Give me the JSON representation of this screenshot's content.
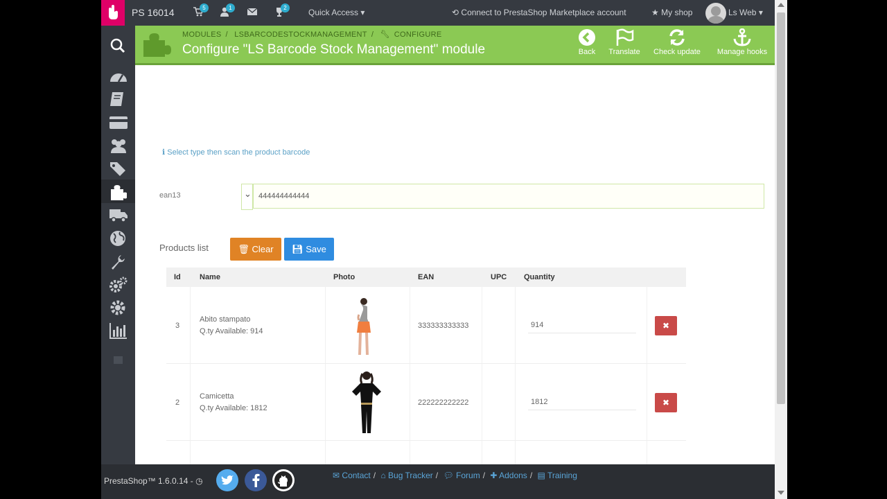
{
  "topbar": {
    "version": "PS 16014",
    "cart_badge": "5",
    "customers_badge": "1",
    "trophy_badge": "2",
    "quick_access": "Quick Access",
    "connect": "Connect to PrestaShop Marketplace account",
    "my_shop": "My shop",
    "user": "Ls Web"
  },
  "header": {
    "breadcrumb": [
      "MODULES",
      "LSBARCODESTOCKMANAGEMENT",
      "CONFIGURE"
    ],
    "title": "Configure \"LS Barcode Stock Management\" module",
    "buttons": {
      "back": "Back",
      "translate": "Translate",
      "check_update": "Check update",
      "manage_hooks": "Manage hooks"
    }
  },
  "form": {
    "hint": "Select type then scan the product barcode",
    "type_value": "ean13",
    "barcode_value": "444444444444"
  },
  "products": {
    "label": "Products list",
    "clear": "Clear",
    "save": "Save",
    "columns": [
      "Id",
      "Name",
      "Photo",
      "EAN",
      "UPC",
      "Quantity"
    ],
    "rows": [
      {
        "id": "3",
        "name": "Abito stampato",
        "available": "Q.ty Available: 914",
        "ean": "333333333333",
        "upc": "",
        "quantity": "914"
      },
      {
        "id": "2",
        "name": "Camicetta",
        "available": "Q.ty Available: 1812",
        "ean": "222222222222",
        "upc": "",
        "quantity": "1812"
      }
    ]
  },
  "footer": {
    "ps_version": "PrestaShop™ 1.6.0.14 -",
    "links": [
      "Contact",
      "Bug Tracker",
      "Forum",
      "Addons",
      "Training"
    ]
  },
  "colors": {
    "header_green": "#8bc954",
    "clear_orange": "#e08325",
    "save_blue": "#2f8ce0",
    "delete_red": "#c94a48",
    "dark_bar": "#363a41"
  }
}
